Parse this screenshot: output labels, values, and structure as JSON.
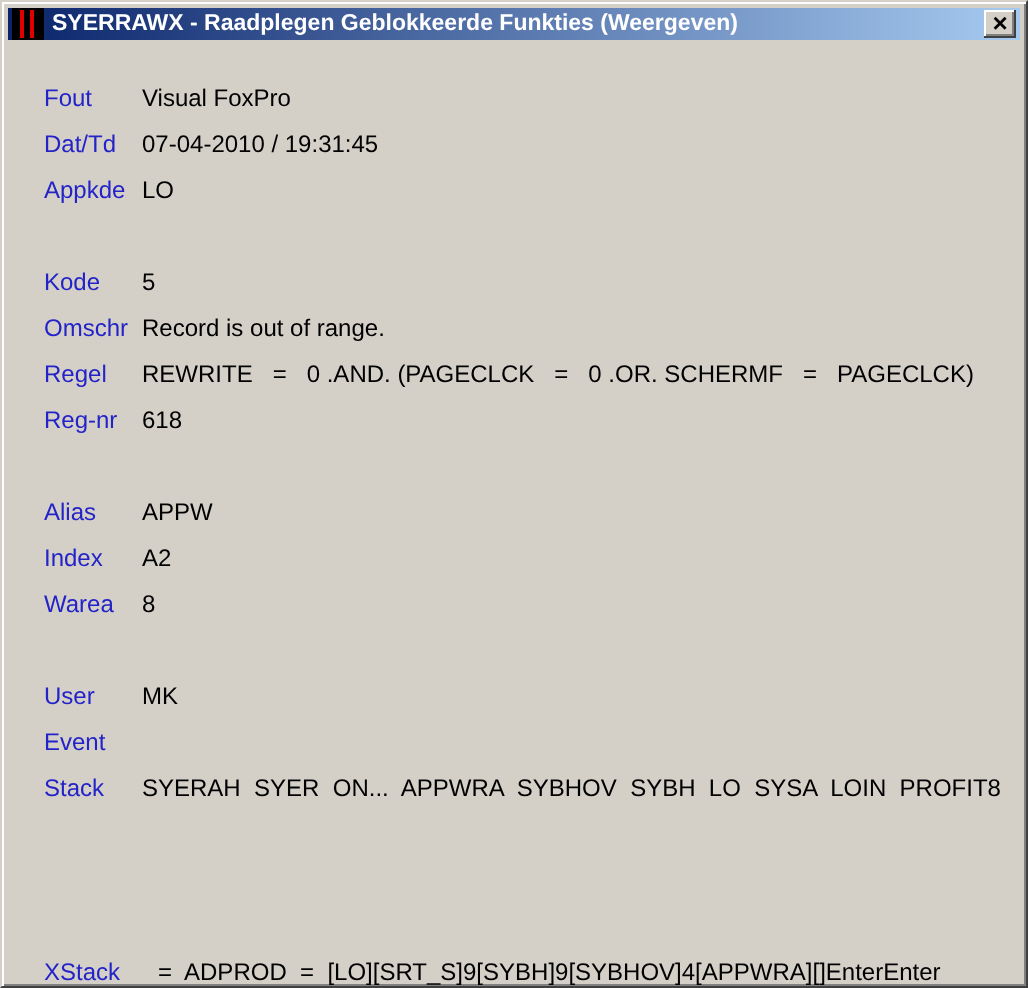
{
  "window": {
    "title": "SYERRAWX - Raadplegen Geblokkeerde Funkties (Weergeven)",
    "close": "×"
  },
  "groups": [
    {
      "rows": [
        {
          "label": "Fout",
          "value": "Visual FoxPro"
        },
        {
          "label": "Dat/Td",
          "value": "07-04-2010 / 19:31:45"
        },
        {
          "label": "Appkde",
          "value": "LO"
        }
      ]
    },
    {
      "rows": [
        {
          "label": "Kode",
          "value": "5"
        },
        {
          "label": "Omschr",
          "value": "Record is out of range."
        },
        {
          "label": "Regel",
          "value": "REWRITE   =   0 .AND. (PAGECLCK   =   0 .OR. SCHERMF   =   PAGECLCK)"
        },
        {
          "label": "Reg-nr",
          "value": "618"
        }
      ]
    },
    {
      "rows": [
        {
          "label": "Alias",
          "value": "APPW"
        },
        {
          "label": "Index",
          "value": "A2"
        },
        {
          "label": "Warea",
          "value": "8"
        }
      ]
    },
    {
      "rows": [
        {
          "label": "User",
          "value": "MK"
        },
        {
          "label": "Event"
        },
        {
          "label": "Stack",
          "value": "SYERAH  SYER  ON...  APPWRA  SYBHOV  SYBH  LO  SYSA  LOIN  PROFIT8"
        }
      ]
    }
  ],
  "footer_row": {
    "label": "XStack",
    "value": "=  ADPROD  =  [LO][SRT_S]9[SYBH]9[SYBHOV]4[APPWRA][]EnterEnter"
  }
}
